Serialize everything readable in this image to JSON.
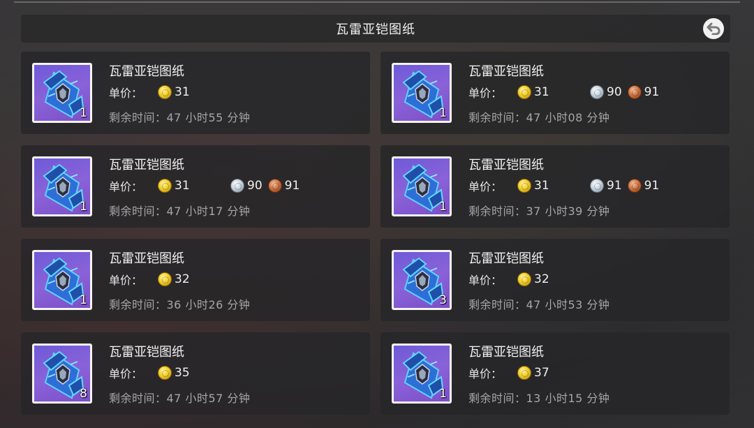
{
  "header": {
    "title": "瓦雷亚铠图纸"
  },
  "listings": [
    {
      "name": "瓦雷亚铠图纸",
      "price_label": "单价：",
      "gold": "31",
      "silver": "",
      "copper": "",
      "quantity": "1",
      "time_left": "剩余时间：47 小时55 分钟"
    },
    {
      "name": "瓦雷亚铠图纸",
      "price_label": "单价：",
      "gold": "31",
      "silver": "90",
      "copper": "91",
      "quantity": "1",
      "time_left": "剩余时间：47 小时08 分钟"
    },
    {
      "name": "瓦雷亚铠图纸",
      "price_label": "单价：",
      "gold": "31",
      "silver": "90",
      "copper": "91",
      "quantity": "1",
      "time_left": "剩余时间：47 小时17 分钟"
    },
    {
      "name": "瓦雷亚铠图纸",
      "price_label": "单价：",
      "gold": "31",
      "silver": "91",
      "copper": "91",
      "quantity": "1",
      "time_left": "剩余时间：37 小时39 分钟"
    },
    {
      "name": "瓦雷亚铠图纸",
      "price_label": "单价：",
      "gold": "32",
      "silver": "",
      "copper": "",
      "quantity": "1",
      "time_left": "剩余时间：36 小时26 分钟"
    },
    {
      "name": "瓦雷亚铠图纸",
      "price_label": "单价：",
      "gold": "32",
      "silver": "",
      "copper": "",
      "quantity": "3",
      "time_left": "剩余时间：47 小时53 分钟"
    },
    {
      "name": "瓦雷亚铠图纸",
      "price_label": "单价：",
      "gold": "35",
      "silver": "",
      "copper": "",
      "quantity": "8",
      "time_left": "剩余时间：47 小时57 分钟"
    },
    {
      "name": "瓦雷亚铠图纸",
      "price_label": "单价：",
      "gold": "37",
      "silver": "",
      "copper": "",
      "quantity": "1",
      "time_left": "剩余时间：13 小时15 分钟"
    }
  ],
  "icons": {
    "back": "return-arrow-icon",
    "gold": "gold-coin-icon",
    "silver": "silver-coin-icon",
    "copper": "copper-coin-icon",
    "item": "armor-blueprint-icon"
  }
}
